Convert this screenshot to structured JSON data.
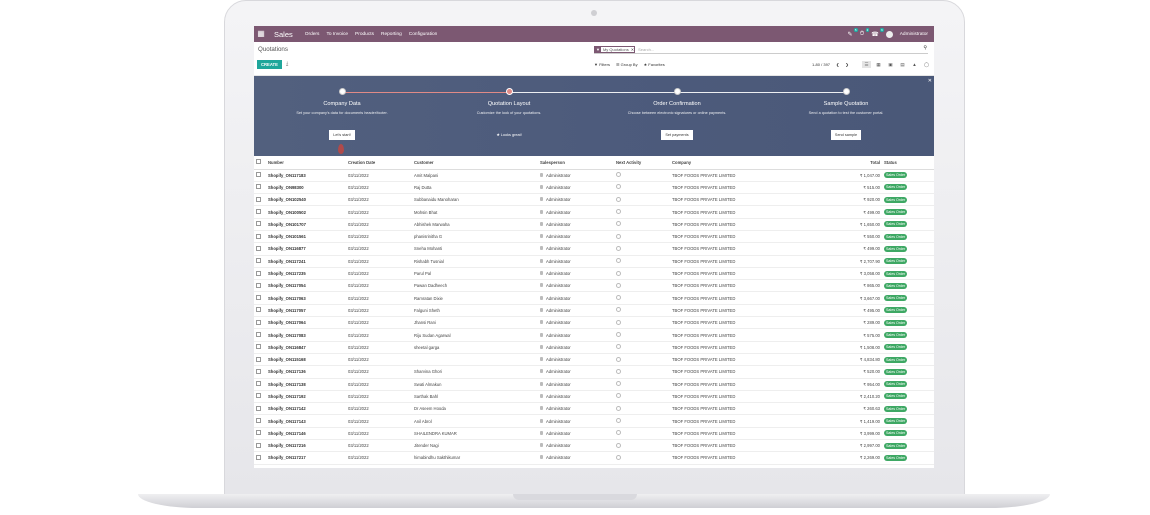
{
  "app": {
    "title": "Sales",
    "menu": [
      "Orders",
      "To Invoice",
      "Products",
      "Reporting",
      "Configuration"
    ],
    "user": "Administrator",
    "badges": [
      "5",
      "2",
      "6"
    ]
  },
  "page": {
    "breadcrumb": "Quotations",
    "create_label": "CREATE",
    "facet_label": "My Quotations",
    "search_placeholder": "Search...",
    "filters": [
      "Filters",
      "Group By",
      "Favorites"
    ],
    "pager": "1-80 / 397"
  },
  "banner": {
    "steps": [
      {
        "title": "Company Data",
        "desc": "Set your company's data for documents header/footer.",
        "button": "Let's start!"
      },
      {
        "title": "Quotation Layout",
        "desc": "Customize the look of your quotations.",
        "button": "Looks great!"
      },
      {
        "title": "Order Confirmation",
        "desc": "Choose between electronic signatures or online payments.",
        "button": "Set payments"
      },
      {
        "title": "Sample Quotation",
        "desc": "Send a quotation to test the customer portal.",
        "button": "Send sample"
      }
    ]
  },
  "table": {
    "headers": [
      "Number",
      "Creation Date",
      "Customer",
      "Salesperson",
      "Next Activity",
      "Company",
      "Total",
      "Status"
    ],
    "rows": [
      [
        "Shopify_ON117183",
        "03/11/2022",
        "Amit Malpani",
        "Administrator",
        "TBOF FOODS PRIVATE LIMITED",
        "₹ 1,047.00",
        "Sales Order"
      ],
      [
        "Shopify_ON98300",
        "03/11/2022",
        "Raj Dutta",
        "Administrator",
        "TBOF FOODS PRIVATE LIMITED",
        "₹ 515.00",
        "Sales Order"
      ],
      [
        "Shopify_ON102540",
        "03/11/2022",
        "Subbanaidu Manoharan",
        "Administrator",
        "TBOF FOODS PRIVATE LIMITED",
        "₹ 920.00",
        "Sales Order"
      ],
      [
        "Shopify_ON100502",
        "03/11/2022",
        "Mohsin Bhat",
        "Administrator",
        "TBOF FOODS PRIVATE LIMITED",
        "₹ 499.00",
        "Sales Order"
      ],
      [
        "Shopify_ON101707",
        "03/11/2022",
        "Abhishek Marwaha",
        "Administrator",
        "TBOF FOODS PRIVATE LIMITED",
        "₹ 1,650.00",
        "Sales Order"
      ],
      [
        "Shopify_ON101561",
        "03/11/2022",
        "phanisrinitha G",
        "Administrator",
        "TBOF FOODS PRIVATE LIMITED",
        "₹ 550.00",
        "Sales Order"
      ],
      [
        "Shopify_ON116877",
        "03/11/2022",
        "Sneha Mohanti",
        "Administrator",
        "TBOF FOODS PRIVATE LIMITED",
        "₹ 499.00",
        "Sales Order"
      ],
      [
        "Shopify_ON117241",
        "03/11/2022",
        "Rishabh Tusnial",
        "Administrator",
        "TBOF FOODS PRIVATE LIMITED",
        "₹ 2,707.90",
        "Sales Order"
      ],
      [
        "Shopify_ON117235",
        "03/11/2022",
        "Parul Pal",
        "Administrator",
        "TBOF FOODS PRIVATE LIMITED",
        "₹ 3,058.00",
        "Sales Order"
      ],
      [
        "Shopify_ON117054",
        "03/11/2022",
        "Pawan Dadheech",
        "Administrator",
        "TBOF FOODS PRIVATE LIMITED",
        "₹ 865.00",
        "Sales Order"
      ],
      [
        "Shopify_ON117063",
        "03/11/2022",
        "Ramratan Dixie",
        "Administrator",
        "TBOF FOODS PRIVATE LIMITED",
        "₹ 3,667.00",
        "Sales Order"
      ],
      [
        "Shopify_ON117057",
        "03/11/2022",
        "Falguni Sheth",
        "Administrator",
        "TBOF FOODS PRIVATE LIMITED",
        "₹ 495.00",
        "Sales Order"
      ],
      [
        "Shopify_ON117064",
        "03/11/2022",
        "Jhansi Rani",
        "Administrator",
        "TBOF FOODS PRIVATE LIMITED",
        "₹ 289.00",
        "Sales Order"
      ],
      [
        "Shopify_ON117083",
        "03/11/2022",
        "Riju Sudan Agarwal",
        "Administrator",
        "TBOF FOODS PRIVATE LIMITED",
        "₹ 575.00",
        "Sales Order"
      ],
      [
        "Shopify_ON116847",
        "03/11/2022",
        "sheetal garga",
        "Administrator",
        "TBOF FOODS PRIVATE LIMITED",
        "₹ 1,508.00",
        "Sales Order"
      ],
      [
        "Shopify_ON115168",
        "03/11/2022",
        "",
        "Administrator",
        "TBOF FOODS PRIVATE LIMITED",
        "₹ 4,834.80",
        "Sales Order"
      ],
      [
        "Shopify_ON117136",
        "03/11/2022",
        "Sharvina Ghori",
        "Administrator",
        "TBOF FOODS PRIVATE LIMITED",
        "₹ 520.00",
        "Sales Order"
      ],
      [
        "Shopify_ON117138",
        "03/11/2022",
        "Swati Almakun",
        "Administrator",
        "TBOF FOODS PRIVATE LIMITED",
        "₹ 954.00",
        "Sales Order"
      ],
      [
        "Shopify_ON117192",
        "03/11/2022",
        "Sarthak Bahl",
        "Administrator",
        "TBOF FOODS PRIVATE LIMITED",
        "₹ 2,410.20",
        "Sales Order"
      ],
      [
        "Shopify_ON117142",
        "03/11/2022",
        "Dr Aseem Hooda",
        "Administrator",
        "TBOF FOODS PRIVATE LIMITED",
        "₹ 260.63",
        "Sales Order"
      ],
      [
        "Shopify_ON117143",
        "03/11/2022",
        "Anil Abrol",
        "Administrator",
        "TBOF FOODS PRIVATE LIMITED",
        "₹ 1,419.00",
        "Sales Order"
      ],
      [
        "Shopify_ON117146",
        "03/11/2022",
        "SHAILENDRA KUMAR",
        "Administrator",
        "TBOF FOODS PRIVATE LIMITED",
        "₹ 3,999.00",
        "Sales Order"
      ],
      [
        "Shopify_ON117216",
        "03/11/2022",
        "Jitender Nagi",
        "Administrator",
        "TBOF FOODS PRIVATE LIMITED",
        "₹ 2,997.00",
        "Sales Order"
      ],
      [
        "Shopify_ON117217",
        "03/11/2022",
        "himabindhu Sakthikumar",
        "Administrator",
        "TBOF FOODS PRIVATE LIMITED",
        "₹ 2,269.00",
        "Sales Order"
      ]
    ]
  },
  "colors": {
    "topbar": "#7c5872",
    "create": "#1fa69b",
    "status": "#3ea864"
  }
}
